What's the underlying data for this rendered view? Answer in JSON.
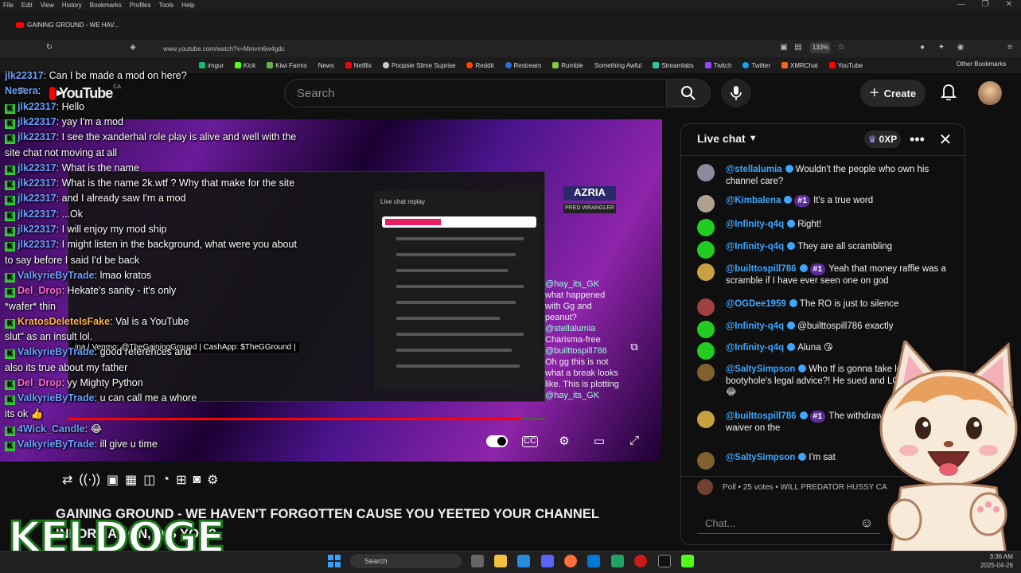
{
  "browser": {
    "menu": [
      "File",
      "Edit",
      "View",
      "History",
      "Bookmarks",
      "Profiles",
      "Tools",
      "Help"
    ],
    "tab_title": "GAINING GROUND - WE HAV...",
    "url": "www.youtube.com/watch?v=Mmvm6w4gdc",
    "zoom": "133%",
    "bookmarks": [
      {
        "label": "imgur",
        "color": "#1bb76e"
      },
      {
        "label": "Kick",
        "color": "#53fc18"
      },
      {
        "label": "Kiwi Farms",
        "color": "#6ab04c"
      },
      {
        "label": "News",
        "color": "#888888"
      },
      {
        "label": "Netflix",
        "color": "#e50914"
      },
      {
        "label": "Poopsie Slime Suprise",
        "color": "#cccccc"
      },
      {
        "label": "Reddit",
        "color": "#ff4500"
      },
      {
        "label": "Restream",
        "color": "#2d6cdf"
      },
      {
        "label": "Rumble",
        "color": "#85c742"
      },
      {
        "label": "Something Awful",
        "color": "#888888"
      },
      {
        "label": "Streamlabs",
        "color": "#31c3a2"
      },
      {
        "label": "Twitch",
        "color": "#9146ff"
      },
      {
        "label": "Twitter",
        "color": "#1da1f2"
      },
      {
        "label": "XMRChat",
        "color": "#f26822"
      },
      {
        "label": "YouTube",
        "color": "#ff0000"
      }
    ],
    "other_bookmarks": "Other Bookmarks"
  },
  "youtube": {
    "logo_text": "YouTube",
    "logo_region": "CA",
    "search_placeholder": "Search",
    "create_label": "Create"
  },
  "video": {
    "inner_chat_title": "Live chat replay",
    "inner_caption": "ina | Venmo: @TheGainingGround | CashApp: $TheGGround |",
    "azria_name": "AZRIA",
    "azria_sub": "PRED WRANGLER",
    "progress": 0.95,
    "side_chat": [
      "@hay_its_GK",
      "what happened",
      "with Gg and",
      "peanut?",
      "@stellalumia",
      "Charisma-free",
      "@builttospill786",
      "Oh gg this is not",
      "what a break looks",
      "like. This is plotting",
      "@hay_its_GK"
    ]
  },
  "overlay_chat": [
    {
      "user": "jlk22317",
      "text": "Can I be made a mod on here?",
      "style": "plain"
    },
    {
      "user": "Nesera",
      "text": "",
      "style": "plain"
    },
    {
      "user": "jlk22317",
      "text": "Hello",
      "style": "mod"
    },
    {
      "user": "jlk22317",
      "text": "yay I'm a mod",
      "style": "mod"
    },
    {
      "user": "jlk22317",
      "text": "I see the xanderhal role play is alive and well with the",
      "style": "mod"
    },
    {
      "user": "",
      "text": "site chat not moving at all",
      "style": "cont"
    },
    {
      "user": "jlk22317",
      "text": "What is the name",
      "style": "mod"
    },
    {
      "user": "jlk22317",
      "text": "What is the name 2k.wtf ? Why that make for the site",
      "style": "mod"
    },
    {
      "user": "jlk22317",
      "text": "and I already saw I'm a mod",
      "style": "mod"
    },
    {
      "user": "jlk22317",
      "text": "...Ok",
      "style": "mod"
    },
    {
      "user": "jlk22317",
      "text": "I will enjoy my mod ship",
      "style": "mod"
    },
    {
      "user": "jlk22317",
      "text": "I might listen in the background, what were you about",
      "style": "mod"
    },
    {
      "user": "",
      "text": "to say before I said I'd be back",
      "style": "cont"
    },
    {
      "user": "ValkyrieByTrade",
      "text": "lmao kratos",
      "style": "k"
    },
    {
      "user": "Del_Drop",
      "text": "Hekate's sanity - it's only",
      "style": "k2"
    },
    {
      "user": "",
      "text": "*wafer* thin",
      "style": "cont"
    },
    {
      "user": "KratosDeleteIsFake",
      "text": "Val is a YouTube",
      "style": "k3"
    },
    {
      "user": "",
      "text": "slut\" as an insult lol.",
      "style": "cont"
    },
    {
      "user": "ValkyrieByTrade",
      "text": "good references and",
      "style": "k"
    },
    {
      "user": "",
      "text": "also its true about my father",
      "style": "cont"
    },
    {
      "user": "Del_Drop",
      "text": "yy Mighty Python",
      "style": "k2"
    },
    {
      "user": "ValkyrieByTrade",
      "text": "u can call me a whore",
      "style": "k"
    },
    {
      "user": "",
      "text": "its ok 👍",
      "style": "cont"
    },
    {
      "user": "4Wick_Candle",
      "text": "😂",
      "style": "k"
    },
    {
      "user": "ValkyrieByTrade",
      "text": "ill give u time",
      "style": "k"
    }
  ],
  "title": {
    "text": "GAINING GROUND - WE HAVEN'T FORGOTTEN CAUSE YOU YEETED YOUR CHANNEL INFORMATION, DIS YOU?",
    "overlay_logo": "KELDOGE"
  },
  "live_chat": {
    "title": "Live chat",
    "xp": "0XP",
    "messages": [
      {
        "user": "@stellalumia",
        "badge": "",
        "text": "Wouldn't the people who own his channel care?",
        "avatar": "#8a8aa0"
      },
      {
        "user": "@Kimbalena",
        "badge": "#1",
        "text": "It's a true word",
        "avatar": "#b0a090"
      },
      {
        "user": "@Infinity-q4q",
        "badge": "",
        "text": "Right!",
        "avatar": "#22cc22"
      },
      {
        "user": "@Infinity-q4q",
        "badge": "",
        "text": "They are all scrambling",
        "avatar": "#22cc22"
      },
      {
        "user": "@builttospill786",
        "badge": "#1",
        "text": "Yeah that money raffle was a scramble if I have ever seen one on god",
        "avatar": "#c8a040"
      },
      {
        "user": "@OGDee1959",
        "badge": "",
        "text": "The RO is just to silence",
        "avatar": "#a04040"
      },
      {
        "user": "@Infinity-q4q",
        "badge": "",
        "text": "@builttospill786 exactly",
        "avatar": "#22cc22"
      },
      {
        "user": "@Infinity-q4q",
        "badge": "",
        "text": "Aluna 😘",
        "avatar": "#22cc22"
      },
      {
        "user": "@SaltySimpson",
        "badge": "",
        "text": "Who tf is gonna take lower bootyhole's legal advice?! He sued and LOST money 😂",
        "avatar": "#806030"
      },
      {
        "user": "@builttospill786",
        "badge": "#1",
        "text": "The withdrawal of the fee waiver on the",
        "avatar": "#c8a040"
      },
      {
        "user": "@SaltySimpson",
        "badge": "",
        "text": "I'm sat",
        "avatar": "#806030"
      }
    ],
    "poll": "Poll • 25 votes • WILL PREDATOR HUSSY CA",
    "input_placeholder": "Chat..."
  },
  "taskbar": {
    "search": "Search",
    "time": "3:36 AM",
    "date": "2025-04-26"
  }
}
